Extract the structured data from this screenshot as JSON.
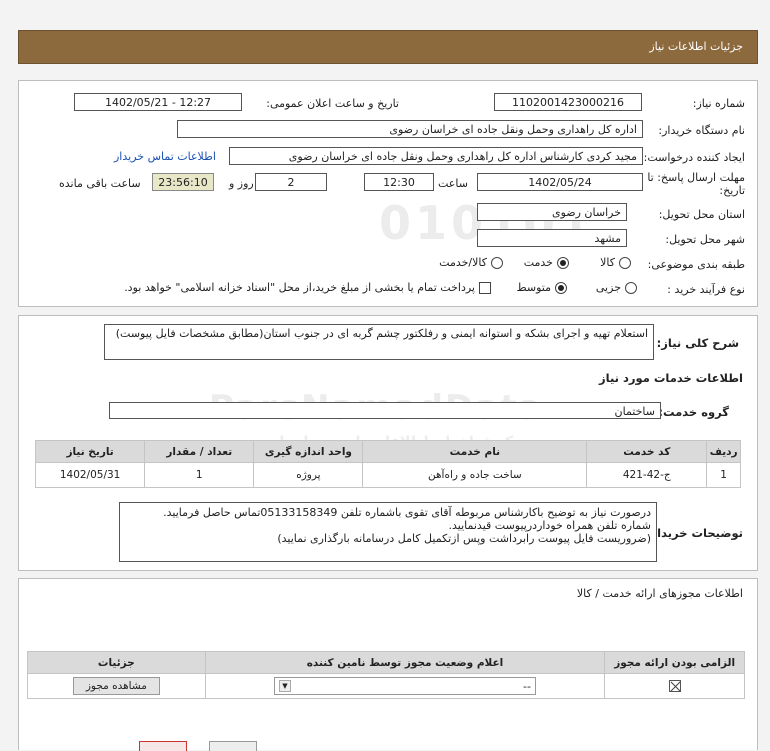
{
  "header": {
    "title": "جزئیات اطلاعات نیاز"
  },
  "need_info": {
    "need_number_label": "شماره نیاز:",
    "need_number": "1102001423000216",
    "announce_label": "تاریخ و ساعت اعلان عمومی:",
    "announce_value": "1402/05/21 - 12:27",
    "buyer_org_label": "نام دستگاه خریدار:",
    "buyer_org": "اداره کل راهداری وحمل ونقل جاده ای خراسان رضوی",
    "creator_label": "ایجاد کننده درخواست:",
    "creator": "مجید کردی کارشناس اداره کل راهداری وحمل ونقل جاده ای خراسان رضوی",
    "contact_link": "اطلاعات تماس خریدار",
    "deadline_label": "مهلت ارسال پاسخ: تا تاریخ:",
    "deadline_date": "1402/05/24",
    "time_label": "ساعت",
    "deadline_time": "12:30",
    "days_value": "2",
    "days_label": "روز و",
    "remaining_time": "23:56:10",
    "remaining_label": "ساعت باقی مانده",
    "province_label": "استان محل تحویل:",
    "province": "خراسان رضوی",
    "city_label": "شهر محل تحویل:",
    "city": "مشهد",
    "category_label": "طبقه بندی موضوعی:",
    "category_options": [
      "کالا",
      "خدمت",
      "کالا/خدمت"
    ],
    "category_selected": "خدمت",
    "process_label": "نوع فرآیند خرید :",
    "process_options": [
      "جزیی",
      "متوسط"
    ],
    "process_selected": "متوسط",
    "payment_note": "پرداخت تمام یا بخشی از مبلغ خرید،از محل \"اسناد خزانه اسلامی\" خواهد بود."
  },
  "description": {
    "label": "شرح کلی نیاز:",
    "text": "استعلام تهیه و اجرای بشکه و استوانه ایمنی و رفلکتور چشم گربه ای در جنوب استان(مطابق مشخصات فایل پیوست)"
  },
  "services": {
    "section_title": "اطلاعات خدمات مورد نیاز",
    "group_label": "گروه خدمت:",
    "group_value": "ساختمان",
    "table_headers": [
      "ردیف",
      "کد خدمت",
      "نام خدمت",
      "واحد اندازه گیری",
      "تعداد / مقدار",
      "تاریخ نیاز"
    ],
    "rows": [
      [
        "1",
        "ج-42-421",
        "ساخت جاده و راه‌آهن",
        "پروژه",
        "1",
        "1402/05/31"
      ]
    ]
  },
  "buyer_notes": {
    "label": "توضیحات خریدار:",
    "text": "درصورت نیاز به توضیح باکارشناس مربوطه آقای تقوی باشماره تلفن 05133158349تماس حاصل فرمایید.\nشماره تلفن همراه خوداردرپیوست قیدنمایید.\n(ضروریست فایل پیوست رابرداشت وپس ازتکمیل کامل درسامانه بارگذاری نمایید)"
  },
  "permits": {
    "section_title": "اطلاعات مجوزهای ارائه خدمت / کالا",
    "table_headers": [
      "الزامی بودن ارائه مجوز",
      "اعلام وضعیت مجوز توسط نامین کننده",
      "جزئیات"
    ],
    "select_value": "--",
    "view_button": "مشاهده مجوز"
  },
  "watermark": {
    "brand": "ParsNamadData",
    "line1": "مرکز فراخوان اطلاعات پارس نماد داده",
    "line2": "پایگاه اطلاع رسانی مناقصه ومزایده",
    "phone": "۰۲۱-۸۸۳۴۹۶۷۰",
    "digits": "010101"
  }
}
